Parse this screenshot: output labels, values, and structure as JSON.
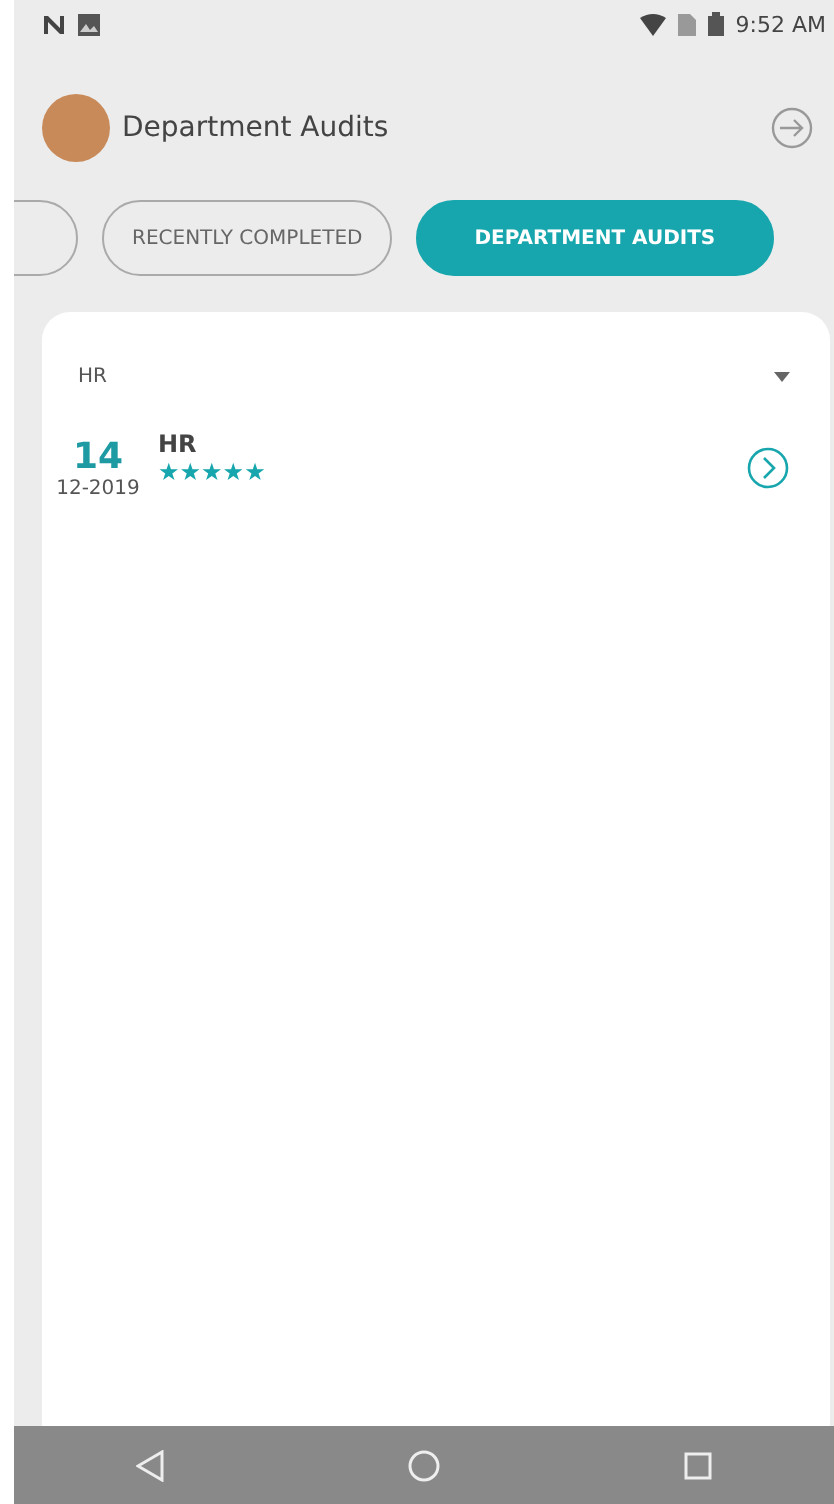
{
  "status_bar": {
    "time": "9:52 AM"
  },
  "header": {
    "title": "Department Audits"
  },
  "tabs": [
    {
      "selected": false
    },
    {
      "label": "RECENTLY COMPLETED",
      "selected": false
    },
    {
      "label": "DEPARTMENT AUDITS",
      "selected": true
    }
  ],
  "filter": {
    "value": "HR"
  },
  "audits": [
    {
      "day": "14",
      "month_year": "12-2019",
      "department": "HR",
      "stars": 5
    }
  ]
}
